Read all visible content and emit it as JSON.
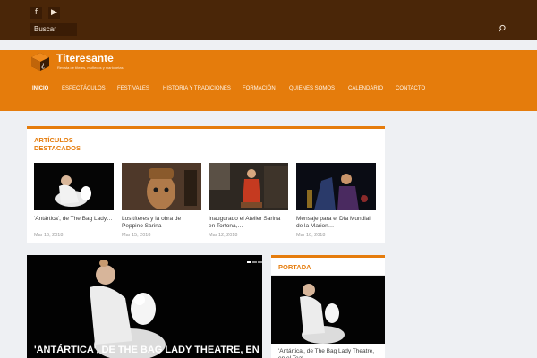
{
  "topbar": {
    "social": [
      {
        "name": "facebook",
        "glyph": "f"
      },
      {
        "name": "youtube",
        "glyph": "▶"
      }
    ],
    "search_label": "Buscar"
  },
  "header": {
    "site_title": "Titeresante",
    "tagline": "Revista de títeres, muñecos y marionetas",
    "nav": [
      "INICIO",
      "ESPECTÁCULOS",
      "FESTIVALES",
      "HISTORIA Y TRADICIONES",
      "FORMACIÓN",
      "QUIENES SOMOS",
      "CALENDARIO",
      "CONTACTO"
    ],
    "active_nav": "INICIO"
  },
  "featured": {
    "title": "ARTÍCULOS DESTACADOS",
    "cards": [
      {
        "title": "'Antártica', de The Bag Lady…",
        "date": "Mar 16, 2018"
      },
      {
        "title": "Los títeres y la obra de Peppino Sarina",
        "date": "Mar 15, 2018"
      },
      {
        "title": "Inaugurado el Atelier Sarina en Tortona,…",
        "date": "Mar 12, 2018"
      },
      {
        "title": "Mensaje para el Día Mundial de la Marion…",
        "date": "Mar 10, 2018"
      }
    ]
  },
  "slider": {
    "caption": "'ANTÁRTICA', DE THE BAG LADY THEATRE, EN EL",
    "dots": 5,
    "active_dot": 0
  },
  "portada": {
    "title": "PORTADA",
    "text": "'Antártica', de The Bag Lady Theatre, en el Teat…"
  },
  "colors": {
    "topbar": "#4a2608",
    "accent": "#e57c0c",
    "background": "#eef0f3"
  }
}
